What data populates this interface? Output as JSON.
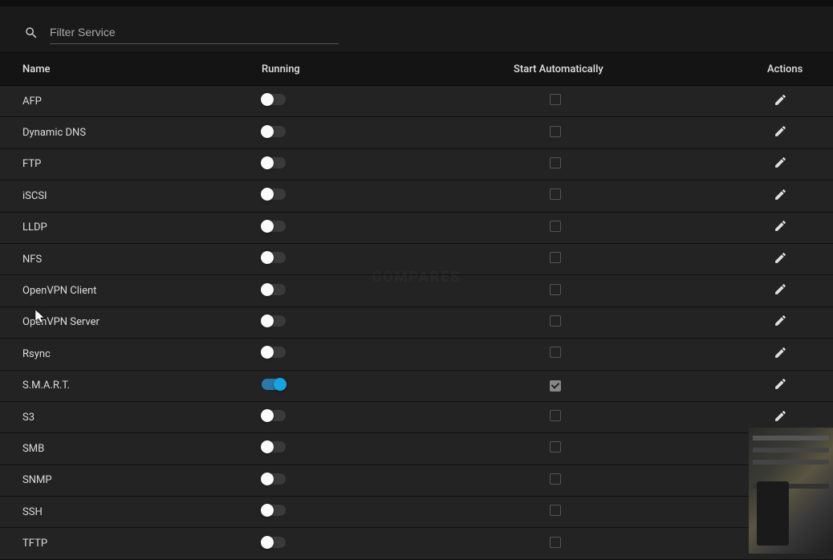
{
  "search": {
    "placeholder": "Filter Service"
  },
  "columns": {
    "name": "Name",
    "running": "Running",
    "start": "Start Automatically",
    "actions": "Actions"
  },
  "services": [
    {
      "name": "AFP",
      "running": false,
      "auto": false
    },
    {
      "name": "Dynamic DNS",
      "running": false,
      "auto": false
    },
    {
      "name": "FTP",
      "running": false,
      "auto": false
    },
    {
      "name": "iSCSI",
      "running": false,
      "auto": false
    },
    {
      "name": "LLDP",
      "running": false,
      "auto": false
    },
    {
      "name": "NFS",
      "running": false,
      "auto": false
    },
    {
      "name": "OpenVPN Client",
      "running": false,
      "auto": false
    },
    {
      "name": "OpenVPN Server",
      "running": false,
      "auto": false
    },
    {
      "name": "Rsync",
      "running": false,
      "auto": false
    },
    {
      "name": "S.M.A.R.T.",
      "running": true,
      "auto": true
    },
    {
      "name": "S3",
      "running": false,
      "auto": false
    },
    {
      "name": "SMB",
      "running": false,
      "auto": false
    },
    {
      "name": "SNMP",
      "running": false,
      "auto": false
    },
    {
      "name": "SSH",
      "running": false,
      "auto": false
    },
    {
      "name": "TFTP",
      "running": false,
      "auto": false
    }
  ],
  "watermark": "COMPARES"
}
